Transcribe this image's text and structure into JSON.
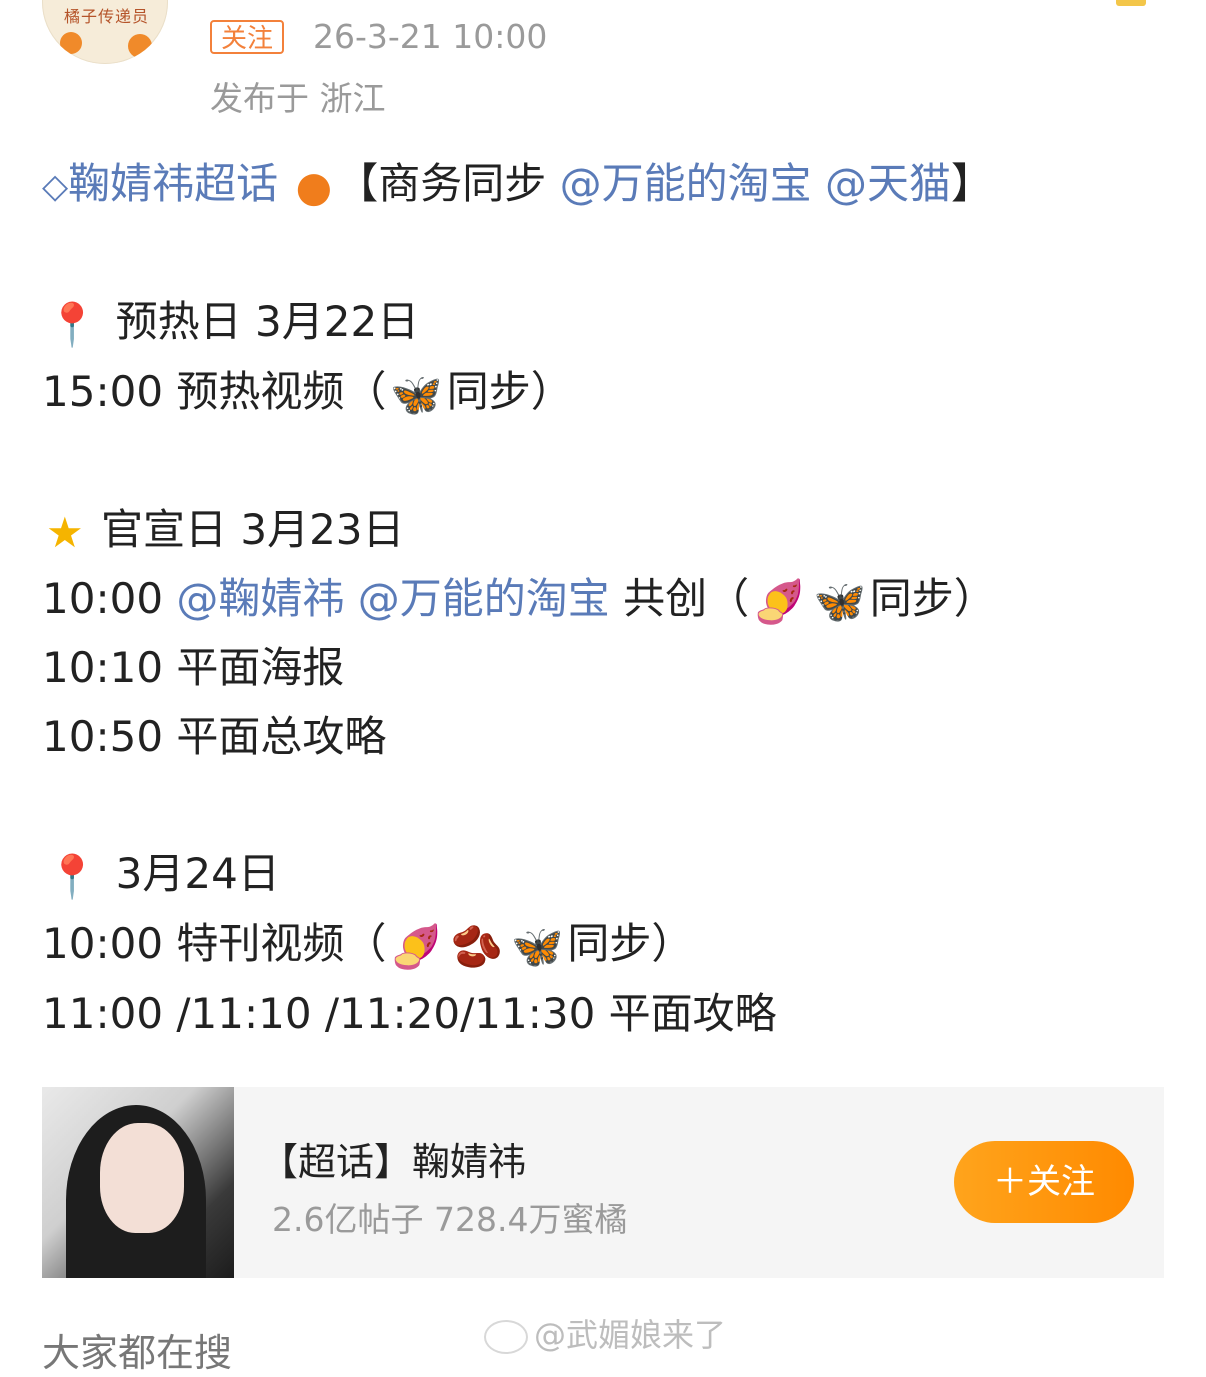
{
  "header": {
    "follow_tag": "关注",
    "time": "26-3-21 10:00",
    "location": "发布于 浙江",
    "avatar_text": "橘子传递员"
  },
  "post": {
    "line1": {
      "topic": "鞠婧祎超话",
      "prefix": "【商务同步",
      "mention1": "@万能的淘宝",
      "mention2": "@天猫",
      "suffix": "】"
    },
    "day1": {
      "title": "预热日 3月22日",
      "item1_time": "15:00",
      "item1_text": "预热视频（",
      "item1_end": "同步）"
    },
    "day2": {
      "title": "官宣日 3月23日",
      "item1_time": "10:00",
      "item1_mention1": "@鞠婧祎",
      "item1_mention2": "@万能的淘宝",
      "item1_text": "共创（",
      "item1_end": "同步）",
      "item2": "10:10 平面海报",
      "item3": "10:50 平面总攻略"
    },
    "day3": {
      "title": "3月24日",
      "item1_time": "10:00",
      "item1_text": "特刊视频（",
      "item1_end": "同步）",
      "item2": "11:00 /11:10 /11:20/11:30 平面攻略"
    }
  },
  "card": {
    "title": "【超话】鞠婧祎",
    "stats": "2.6亿帖子 728.4万蜜橘",
    "follow_button": "＋关注"
  },
  "footer": {
    "section_label": "大家都在搜",
    "watermark": "@武媚娘来了"
  },
  "icons": [
    "diamond-icon",
    "orange-emoji",
    "pin-icon",
    "butterfly-emoji",
    "star-emoji",
    "sweet-potato-emoji",
    "beans-emoji",
    "weibo-icon"
  ],
  "colors": {
    "link": "#5a7bb8",
    "accent": "#f3813b",
    "follow_button": "#ff9a0f"
  }
}
